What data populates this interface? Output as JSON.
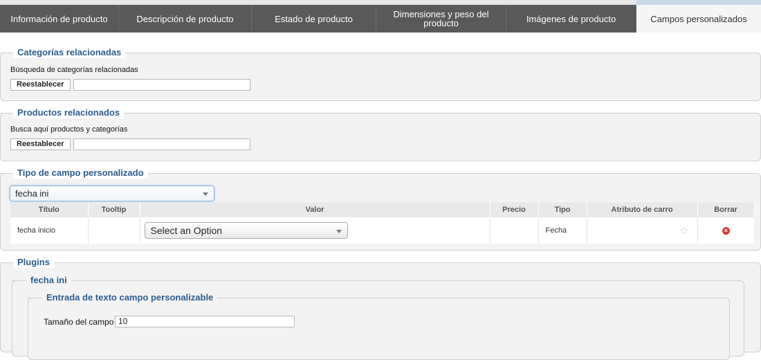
{
  "tabs": [
    {
      "label": "Información de producto"
    },
    {
      "label": "Descripción de producto"
    },
    {
      "label": "Estado de producto"
    },
    {
      "label": "Dimensiones y peso del producto"
    },
    {
      "label": "Imágenes de producto"
    },
    {
      "label": "Campos personalizados"
    }
  ],
  "categorias": {
    "legend": "Categorías relacionadas",
    "hint": "Búsqueda de categorías relacionadas",
    "reset_label": "Reestablecer",
    "search_value": ""
  },
  "productos": {
    "legend": "Productos relacionados",
    "hint": "Busca aquí productos y categorías",
    "reset_label": "Reestablecer",
    "search_value": ""
  },
  "tipo_campo": {
    "legend": "Tipo de campo personalizado",
    "selected": "fecha ini",
    "columns": [
      "Título",
      "Tooltip",
      "Valor",
      "Precio",
      "Tipo",
      "Atributo de carro",
      "Borrar"
    ],
    "row": {
      "titulo": "fecha inicio",
      "tooltip": "",
      "valor_select": "Select an Option",
      "precio": "",
      "tipo": "Fecha",
      "atributo_icon": "star-icon",
      "borrar_icon": "delete-icon"
    }
  },
  "plugins": {
    "legend": "Plugins",
    "sub_legend": "fecha ini",
    "inner_legend": "Entrada de texto campo personalizable",
    "field_label": "Tamaño del campo",
    "field_value": "10"
  },
  "colors": {
    "tab_bar": "#595959",
    "legend_text": "#2b5d8f",
    "delete": "#d83a2f"
  }
}
